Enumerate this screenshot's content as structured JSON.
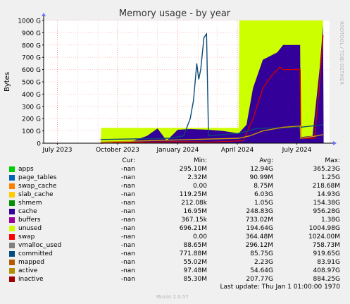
{
  "chart_data": {
    "type": "area",
    "title": "Memory usage - by year",
    "ylabel": "Bytes",
    "watermark": "RRDTOOL / TOBI OETIKER",
    "ylim": [
      0,
      1000
    ],
    "y_unit": "G",
    "y_ticks": [
      "0",
      "100 G",
      "200 G",
      "300 G",
      "400 G",
      "500 G",
      "600 G",
      "700 G",
      "800 G",
      "900 G",
      "1000 G"
    ],
    "x_ticks": [
      "July 2023",
      "October 2023",
      "January 2024",
      "April 2024",
      "July 2024"
    ],
    "x_range": [
      "2023-06-10",
      "2024-08-20"
    ],
    "colors": {
      "background": "#f0f0f0",
      "plot_bg": "#ffffff",
      "grid_minor": "#ffcccc",
      "axis": "#000000"
    },
    "stacked_areas": [
      {
        "name": "unused",
        "color": "#ccff00",
        "points": [
          [
            "2023-09-05",
            0
          ],
          [
            "2023-09-06",
            125
          ],
          [
            "2024-04-03",
            125
          ],
          [
            "2024-04-04",
            1000
          ],
          [
            "2024-08-10",
            1000
          ],
          [
            "2024-08-11",
            0
          ]
        ]
      },
      {
        "name": "cache",
        "color": "#330099",
        "points": [
          [
            "2023-09-05",
            0
          ],
          [
            "2023-10-20",
            10
          ],
          [
            "2023-11-15",
            60
          ],
          [
            "2023-12-01",
            120
          ],
          [
            "2023-12-15",
            20
          ],
          [
            "2024-01-01",
            110
          ],
          [
            "2024-01-20",
            115
          ],
          [
            "2024-02-15",
            110
          ],
          [
            "2024-03-10",
            100
          ],
          [
            "2024-04-03",
            80
          ],
          [
            "2024-04-15",
            150
          ],
          [
            "2024-04-25",
            450
          ],
          [
            "2024-05-10",
            680
          ],
          [
            "2024-06-01",
            740
          ],
          [
            "2024-06-10",
            800
          ],
          [
            "2024-07-06",
            800
          ],
          [
            "2024-07-07",
            50
          ],
          [
            "2024-07-25",
            60
          ],
          [
            "2024-08-05",
            620
          ],
          [
            "2024-08-10",
            960
          ],
          [
            "2024-08-11",
            0
          ]
        ]
      }
    ],
    "lines": [
      {
        "name": "swap",
        "color": "#cc0000",
        "points": [
          [
            "2023-09-05",
            0
          ],
          [
            "2023-10-01",
            5
          ],
          [
            "2023-12-01",
            10
          ],
          [
            "2024-01-15",
            12
          ],
          [
            "2024-02-20",
            8
          ],
          [
            "2024-04-10",
            20
          ],
          [
            "2024-04-25",
            200
          ],
          [
            "2024-05-10",
            450
          ],
          [
            "2024-05-25",
            560
          ],
          [
            "2024-06-05",
            620
          ],
          [
            "2024-06-10",
            600
          ],
          [
            "2024-07-06",
            600
          ],
          [
            "2024-07-07",
            40
          ],
          [
            "2024-07-28",
            40
          ],
          [
            "2024-08-05",
            500
          ],
          [
            "2024-08-10",
            880
          ]
        ]
      },
      {
        "name": "committed",
        "color": "#0a4a78",
        "points": [
          [
            "2023-09-05",
            30
          ],
          [
            "2023-12-20",
            40
          ],
          [
            "2024-01-10",
            60
          ],
          [
            "2024-01-20",
            200
          ],
          [
            "2024-01-25",
            350
          ],
          [
            "2024-01-30",
            650
          ],
          [
            "2024-02-02",
            520
          ],
          [
            "2024-02-05",
            600
          ],
          [
            "2024-02-10",
            860
          ],
          [
            "2024-02-14",
            890
          ],
          [
            "2024-02-17",
            60
          ],
          [
            "2024-03-10",
            70
          ],
          [
            "2024-04-03",
            80
          ],
          [
            "2024-05-01",
            120
          ],
          [
            "2024-07-06",
            130
          ],
          [
            "2024-08-10",
            150
          ]
        ]
      },
      {
        "name": "active",
        "color": "#cc9900",
        "points": [
          [
            "2023-09-05",
            10
          ],
          [
            "2024-04-03",
            40
          ],
          [
            "2024-04-20",
            60
          ],
          [
            "2024-05-10",
            100
          ],
          [
            "2024-06-10",
            130
          ],
          [
            "2024-07-06",
            140
          ],
          [
            "2024-07-07",
            40
          ],
          [
            "2024-08-01",
            60
          ],
          [
            "2024-08-10",
            70
          ]
        ]
      }
    ],
    "legend": {
      "headers": {
        "cur": "Cur:",
        "min": "Min:",
        "avg": "Avg:",
        "max": "Max:"
      },
      "rows": [
        {
          "name": "apps",
          "color": "#00cc00",
          "cur": "-nan",
          "min": "295.10M",
          "avg": "12.94G",
          "max": "365.23G"
        },
        {
          "name": "page_tables",
          "color": "#0066b3",
          "cur": "-nan",
          "min": "2.32M",
          "avg": "90.99M",
          "max": "1.25G"
        },
        {
          "name": "swap_cache",
          "color": "#ff8000",
          "cur": "-nan",
          "min": "0.00",
          "avg": "8.75M",
          "max": "218.68M"
        },
        {
          "name": "slab_cache",
          "color": "#ffcc00",
          "cur": "-nan",
          "min": "119.25M",
          "avg": "6.03G",
          "max": "14.93G"
        },
        {
          "name": "shmem",
          "color": "#008f00",
          "cur": "-nan",
          "min": "212.08k",
          "avg": "1.05G",
          "max": "154.38G"
        },
        {
          "name": "cache",
          "color": "#330099",
          "cur": "-nan",
          "min": "16.95M",
          "avg": "248.83G",
          "max": "956.28G"
        },
        {
          "name": "buffers",
          "color": "#990099",
          "cur": "-nan",
          "min": "367.15k",
          "avg": "733.02M",
          "max": "1.38G"
        },
        {
          "name": "unused",
          "color": "#ccff00",
          "cur": "-nan",
          "min": "696.21M",
          "avg": "194.64G",
          "max": "1004.98G"
        },
        {
          "name": "swap",
          "color": "#ff0000",
          "cur": "-nan",
          "min": "0.00",
          "avg": "364.48M",
          "max": "1024.00M"
        },
        {
          "name": "vmalloc_used",
          "color": "#808080",
          "cur": "-nan",
          "min": "88.65M",
          "avg": "296.12M",
          "max": "758.73M"
        },
        {
          "name": "committed",
          "color": "#004d80",
          "cur": "-nan",
          "min": "771.88M",
          "avg": "85.75G",
          "max": "919.65G"
        },
        {
          "name": "mapped",
          "color": "#b35a00",
          "cur": "-nan",
          "min": "55.02M",
          "avg": "2.23G",
          "max": "83.91G"
        },
        {
          "name": "active",
          "color": "#b38f00",
          "cur": "-nan",
          "min": "97.48M",
          "avg": "54.64G",
          "max": "408.97G"
        },
        {
          "name": "inactive",
          "color": "#a00000",
          "cur": "-nan",
          "min": "85.30M",
          "avg": "207.77G",
          "max": "884.25G"
        }
      ]
    },
    "last_update": "Last update: Thu Jan  1 01:00:00 1970",
    "munin_version": "Munin 2.0.57"
  }
}
